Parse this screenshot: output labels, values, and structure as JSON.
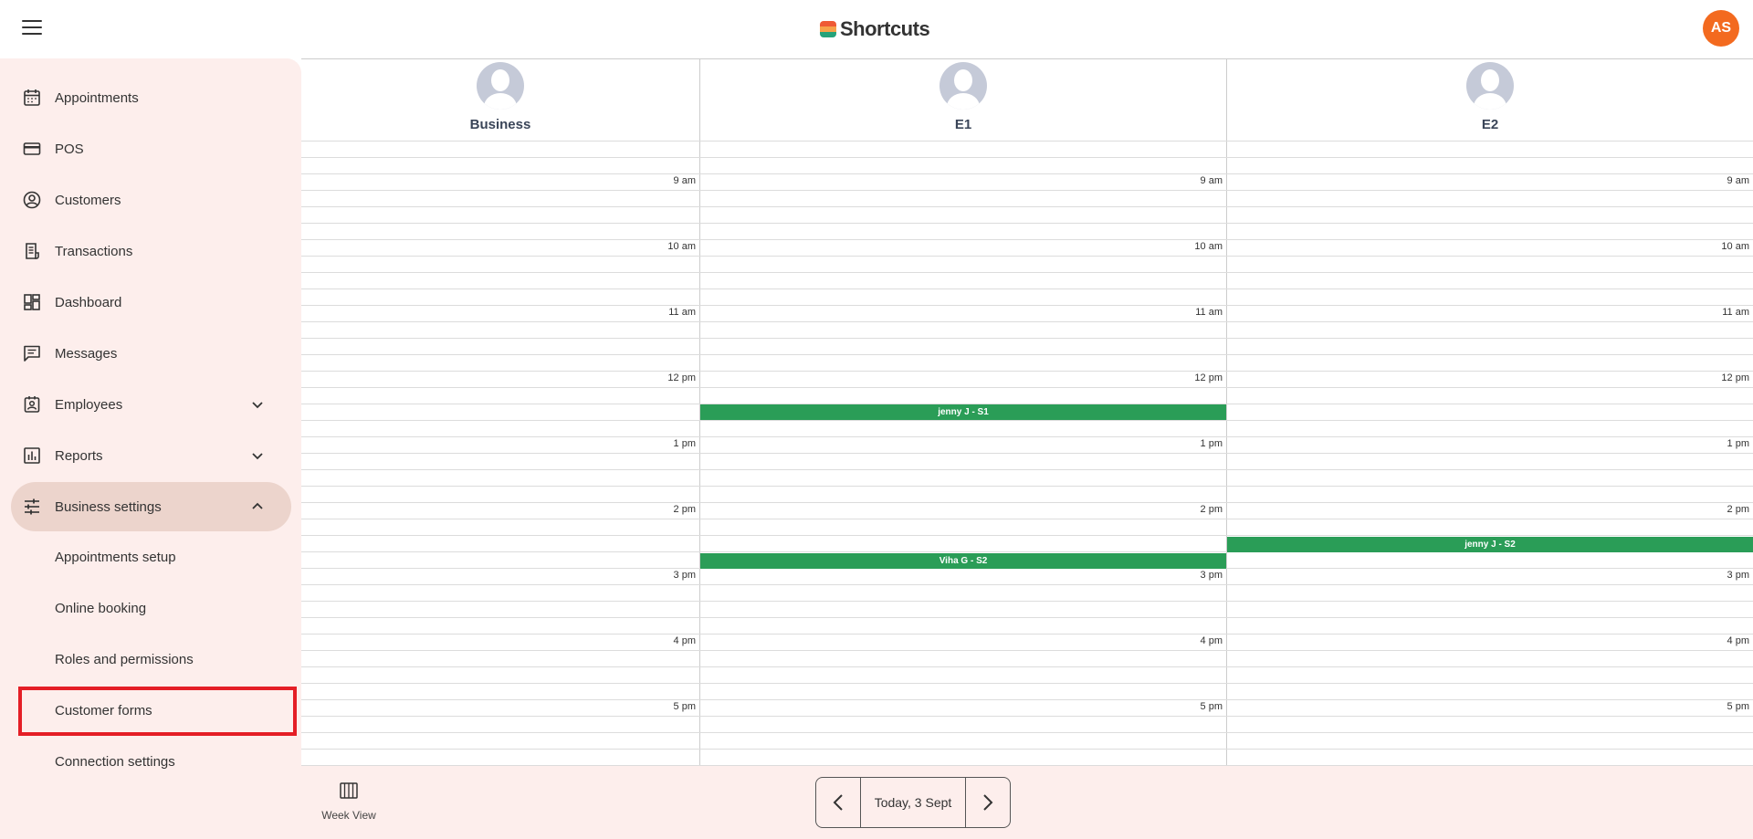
{
  "header": {
    "brand": "Shortcuts",
    "user_initials": "AS",
    "colors": {
      "avatar": "#f36a1f",
      "brand_red": "#ef5a35",
      "brand_orange": "#f7a24a",
      "brand_green": "#25a37a"
    }
  },
  "sidebar": {
    "items": [
      {
        "label": "Appointments",
        "icon": "calendar-icon"
      },
      {
        "label": "POS",
        "icon": "credit-card-icon"
      },
      {
        "label": "Customers",
        "icon": "user-circle-icon"
      },
      {
        "label": "Transactions",
        "icon": "receipt-icon"
      },
      {
        "label": "Dashboard",
        "icon": "dashboard-icon"
      },
      {
        "label": "Messages",
        "icon": "message-icon"
      },
      {
        "label": "Employees",
        "icon": "badge-icon"
      },
      {
        "label": "Reports",
        "icon": "bar-chart-icon"
      },
      {
        "label": "Business settings",
        "icon": "sliders-icon"
      }
    ],
    "sub_items": [
      "Appointments setup",
      "Online booking",
      "Roles and permissions",
      "Customer forms",
      "Connection settings"
    ],
    "highlighted": "Customer forms"
  },
  "calendar": {
    "columns": [
      "Business",
      "E1",
      "E2"
    ],
    "time_labels": [
      "9 am",
      "10 am",
      "11 am",
      "12 pm",
      "1 pm",
      "2 pm",
      "3 pm",
      "4 pm",
      "5 pm"
    ],
    "appointments": [
      {
        "label": "jenny J - S1",
        "column": "E1"
      },
      {
        "label": "Viha G - S2",
        "column": "E1"
      },
      {
        "label": "jenny J - S2",
        "column": "E2"
      }
    ],
    "colors": {
      "appointment": "#2a9d57"
    }
  },
  "footer": {
    "week_view_label": "Week View",
    "date_label": "Today, 3 Sept"
  }
}
